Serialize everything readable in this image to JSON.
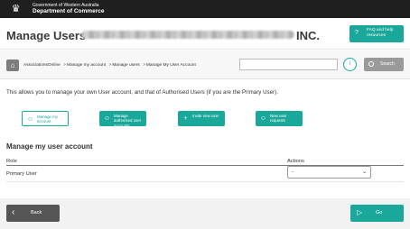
{
  "topbar": {
    "crest_icon": "coat-of-arms-icon",
    "gov_line1": "Government of Western Australia",
    "gov_line2": "Department of Commerce"
  },
  "header": {
    "title": "Manage Users -",
    "title_suffix": "INC.",
    "faq_label": "FAQ and help resources",
    "faq_icon": "?"
  },
  "breadcrumb": {
    "items": [
      "AssociationsOnline",
      "Manage my account",
      "Manage users",
      "Manage My User Account"
    ],
    "separator": ">"
  },
  "search": {
    "placeholder": "",
    "help_icon": "i",
    "button_label": "Search"
  },
  "intro_text": "This allows you to manage your own User account, and that of Authorised Users (if you are the Primary User).",
  "tiles": [
    {
      "label": "Manage my account",
      "icon": "person-icon",
      "style": "outline"
    },
    {
      "label": "Manage authorised user accounts",
      "icon": "users-icon",
      "style": "filled"
    },
    {
      "label": "Invite new user",
      "icon": "add-user-icon",
      "style": "filled"
    },
    {
      "label": "New user requests",
      "icon": "user-request-icon",
      "style": "filled"
    }
  ],
  "account_section": {
    "title": "Manage my user account",
    "columns": [
      "Role",
      "Actions"
    ],
    "rows": [
      {
        "role": "Primary User",
        "action_selected": "-"
      }
    ]
  },
  "footer": {
    "back_label": "Back",
    "go_label": "Go"
  },
  "colors": {
    "accent": "#1aa89a",
    "topbar": "#1f1f1f",
    "back_button": "#555555",
    "search_button": "#9a9a9a"
  }
}
